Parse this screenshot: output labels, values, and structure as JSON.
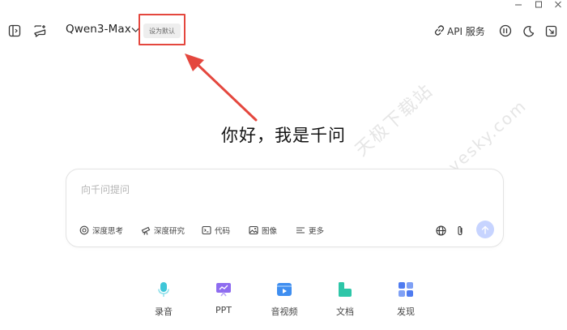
{
  "header": {
    "model_name": "Qwen3-Max",
    "set_default_label": "设为默认",
    "api_label": "API 服务"
  },
  "main": {
    "greeting": "你好，我是千问"
  },
  "composer": {
    "placeholder": "向千问提问",
    "tools": [
      {
        "label": "深度思考",
        "icon": "brain-icon"
      },
      {
        "label": "深度研究",
        "icon": "telescope-icon"
      },
      {
        "label": "代码",
        "icon": "code-icon"
      },
      {
        "label": "图像",
        "icon": "image-icon"
      },
      {
        "label": "更多",
        "icon": "menu-icon"
      }
    ]
  },
  "shortcuts": [
    {
      "label": "录音",
      "icon": "microphone-icon",
      "color": "#3ec6d8"
    },
    {
      "label": "PPT",
      "icon": "presentation-icon",
      "color": "#8e6cf0"
    },
    {
      "label": "音视频",
      "icon": "video-icon",
      "color": "#3f8ef0"
    },
    {
      "label": "文档",
      "icon": "document-icon",
      "color": "#2ec6a8"
    },
    {
      "label": "发现",
      "icon": "grid-icon",
      "color": "#4f7bf0"
    }
  ],
  "watermark": {
    "line1": "天极下载站",
    "line2": "mydown.yesky.com"
  },
  "colors": {
    "annotation_red": "#e4473e",
    "send_button": "#c7d4ff"
  }
}
